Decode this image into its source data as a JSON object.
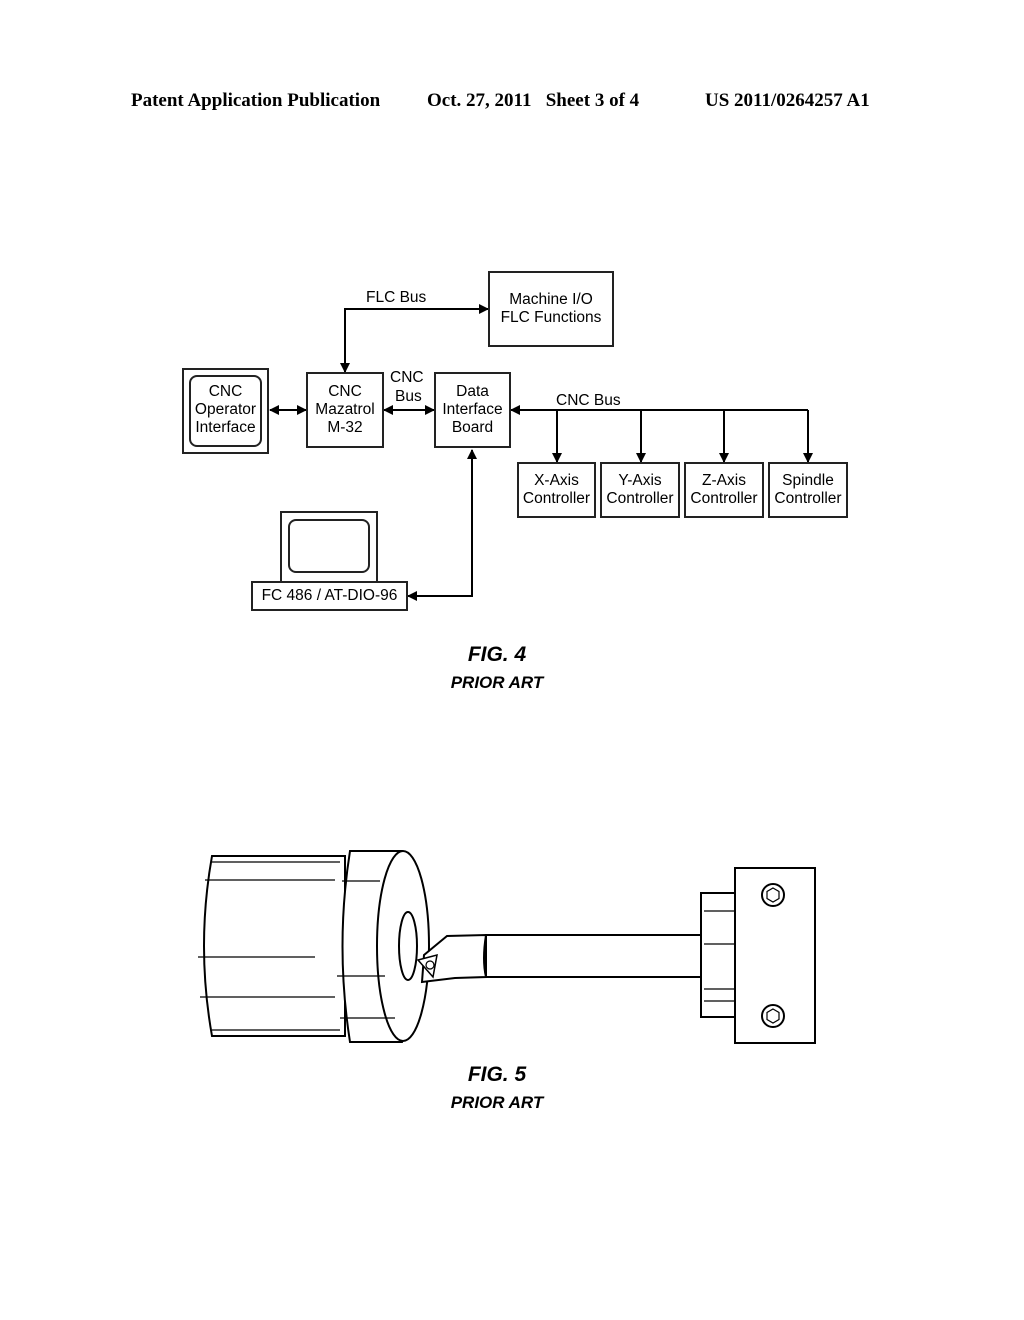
{
  "header": {
    "publication": "Patent Application Publication",
    "date_sheet": "Oct. 27, 2011   Sheet 3 of 4",
    "number": "US 2011/0264257 A1"
  },
  "fig4": {
    "title": "FIG. 4",
    "subtitle": "PRIOR ART",
    "blocks": {
      "operator": [
        "CNC",
        "Operator",
        "Interface"
      ],
      "mazatrol": [
        "CNC",
        "Mazatrol",
        "M-32"
      ],
      "dib": [
        "Data",
        "Interface",
        "Board"
      ],
      "machine_io": [
        "Machine I/O",
        "FLC Functions"
      ],
      "x_axis": [
        "X-Axis",
        "Controller"
      ],
      "y_axis": [
        "Y-Axis",
        "Controller"
      ],
      "z_axis": [
        "Z-Axis",
        "Controller"
      ],
      "spindle": [
        "Spindle",
        "Controller"
      ],
      "pc": "FC 486 / AT-DIO-96"
    },
    "labels": {
      "flc_bus": "FLC Bus",
      "cnc_bus_short_1": "CNC",
      "cnc_bus_short_2": "Bus",
      "cnc_bus": "CNC Bus"
    }
  },
  "fig5": {
    "title": "FIG. 5",
    "subtitle": "PRIOR ART"
  }
}
